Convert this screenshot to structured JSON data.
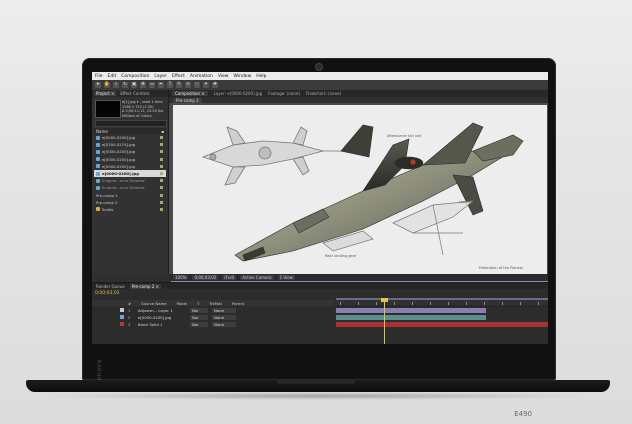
{
  "device": {
    "brand": "Lenovo",
    "model": "E490"
  },
  "app": {
    "menu": [
      "File",
      "Edit",
      "Composition",
      "Layer",
      "Effect",
      "Animation",
      "View",
      "Window",
      "Help"
    ],
    "toolbar_icons": [
      "selection-tool-icon",
      "hand-tool-icon",
      "zoom-tool-icon",
      "rotate-tool-icon",
      "camera-tool-icon",
      "pan-behind-icon",
      "mask-tool-icon",
      "pen-tool-icon",
      "text-tool-icon",
      "brush-tool-icon",
      "clone-stamp-icon",
      "eraser-icon",
      "roto-brush-icon",
      "puppet-tool-icon"
    ]
  },
  "project_panel": {
    "tabs": [
      "Project ×",
      "Effect Controls"
    ],
    "info_lines": [
      "e[1].jpg ▾ , used 1 time",
      "1280 x 720 (1.00)",
      "Δ 0;00;11;12, 24.00 fps",
      "Millions of Colors"
    ],
    "column_header": "Name",
    "items": [
      {
        "label": "e[0000-0200].jpg",
        "type": "footage",
        "style": "normal"
      },
      {
        "label": "e[0200-0274].jpg",
        "type": "footage",
        "style": "normal"
      },
      {
        "label": "e[0000-0200].jpg",
        "type": "footage",
        "style": "normal"
      },
      {
        "label": "e[0000-0200].jpg",
        "type": "footage",
        "style": "normal"
      },
      {
        "label": "e[0000-0200].jpg",
        "type": "footage",
        "style": "normal"
      },
      {
        "label": "e[0000-0200].jpg",
        "type": "footage",
        "style": "selected"
      },
      {
        "label": "Enigma...urce Deleted",
        "type": "footage",
        "style": "dim"
      },
      {
        "label": "Enigma...urce Deleted",
        "type": "footage",
        "style": "dim"
      },
      {
        "label": "Pre-comp 1",
        "type": "comp",
        "style": "normal"
      },
      {
        "label": "Pre-comp 2",
        "type": "comp",
        "style": "normal"
      },
      {
        "label": "Solids",
        "type": "folder",
        "style": "normal"
      }
    ]
  },
  "comp_panel": {
    "tabs": [
      "Composition ×",
      "Layer: e[0000-0200].jpg",
      "Footage: (none)",
      "Flowchart: (none)"
    ],
    "breadcrumb": "Pre-comp 2",
    "captions": {
      "a": "Afterburner tail unit",
      "b": "Rear landing gear",
      "c": "Length: 12m",
      "d": "Federation of the Planets"
    },
    "footer": [
      "100%",
      "0;00;03;02",
      "(Full)",
      "Active Camera",
      "1 View"
    ]
  },
  "timeline": {
    "tabs": [
      "Render Queue",
      "Pre-comp 2 ×"
    ],
    "timecode": "0;00;03;02",
    "columns": [
      "#",
      "Source Name",
      "Mode",
      "T",
      "TrkMat",
      "Parent"
    ],
    "layers": [
      {
        "num": "1",
        "name": "Adjustm... Layer 1",
        "mode": "Nor",
        "parent": "None",
        "label_color": "#c9c9c9",
        "bar_color": "#8a7fb0"
      },
      {
        "num": "2",
        "name": "e[0000-0200].jpg",
        "mode": "Nor",
        "parent": "None",
        "label_color": "#6fa3d4",
        "bar_color": "#5d8f8b"
      },
      {
        "num": "3",
        "name": "Black Solid 1",
        "mode": "Nor",
        "parent": "None",
        "label_color": "#b23a3a",
        "bar_color": "#a53232"
      }
    ]
  },
  "colors": {
    "accent": "#e0c44a",
    "panel": "#323232",
    "canvas": "#ececec"
  }
}
